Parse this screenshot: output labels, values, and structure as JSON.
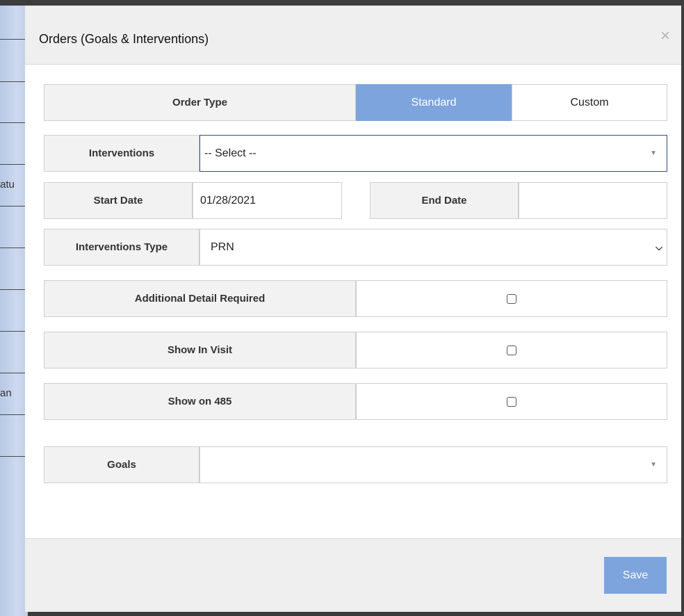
{
  "background": {
    "fragments": [
      "atu",
      "an"
    ]
  },
  "modal": {
    "title": "Orders (Goals & Interventions)",
    "close_icon": "×"
  },
  "order_type": {
    "label": "Order Type",
    "options": [
      "Standard",
      "Custom"
    ],
    "selected": "Standard"
  },
  "interventions": {
    "label": "Interventions",
    "value": "-- Select --"
  },
  "start_date": {
    "label": "Start Date",
    "value": "01/28/2021"
  },
  "end_date": {
    "label": "End Date",
    "value": ""
  },
  "interventions_type": {
    "label": "Interventions Type",
    "value": "PRN"
  },
  "additional_detail": {
    "label": "Additional Detail Required",
    "checked": false
  },
  "show_in_visit": {
    "label": "Show In Visit",
    "checked": false
  },
  "show_on_485": {
    "label": "Show on 485",
    "checked": false
  },
  "goals": {
    "label": "Goals",
    "value": ""
  },
  "footer": {
    "save_label": "Save"
  },
  "colors": {
    "accent": "#7ea4dd",
    "header_bg": "#efefef",
    "label_bg": "#f2f2f2"
  }
}
